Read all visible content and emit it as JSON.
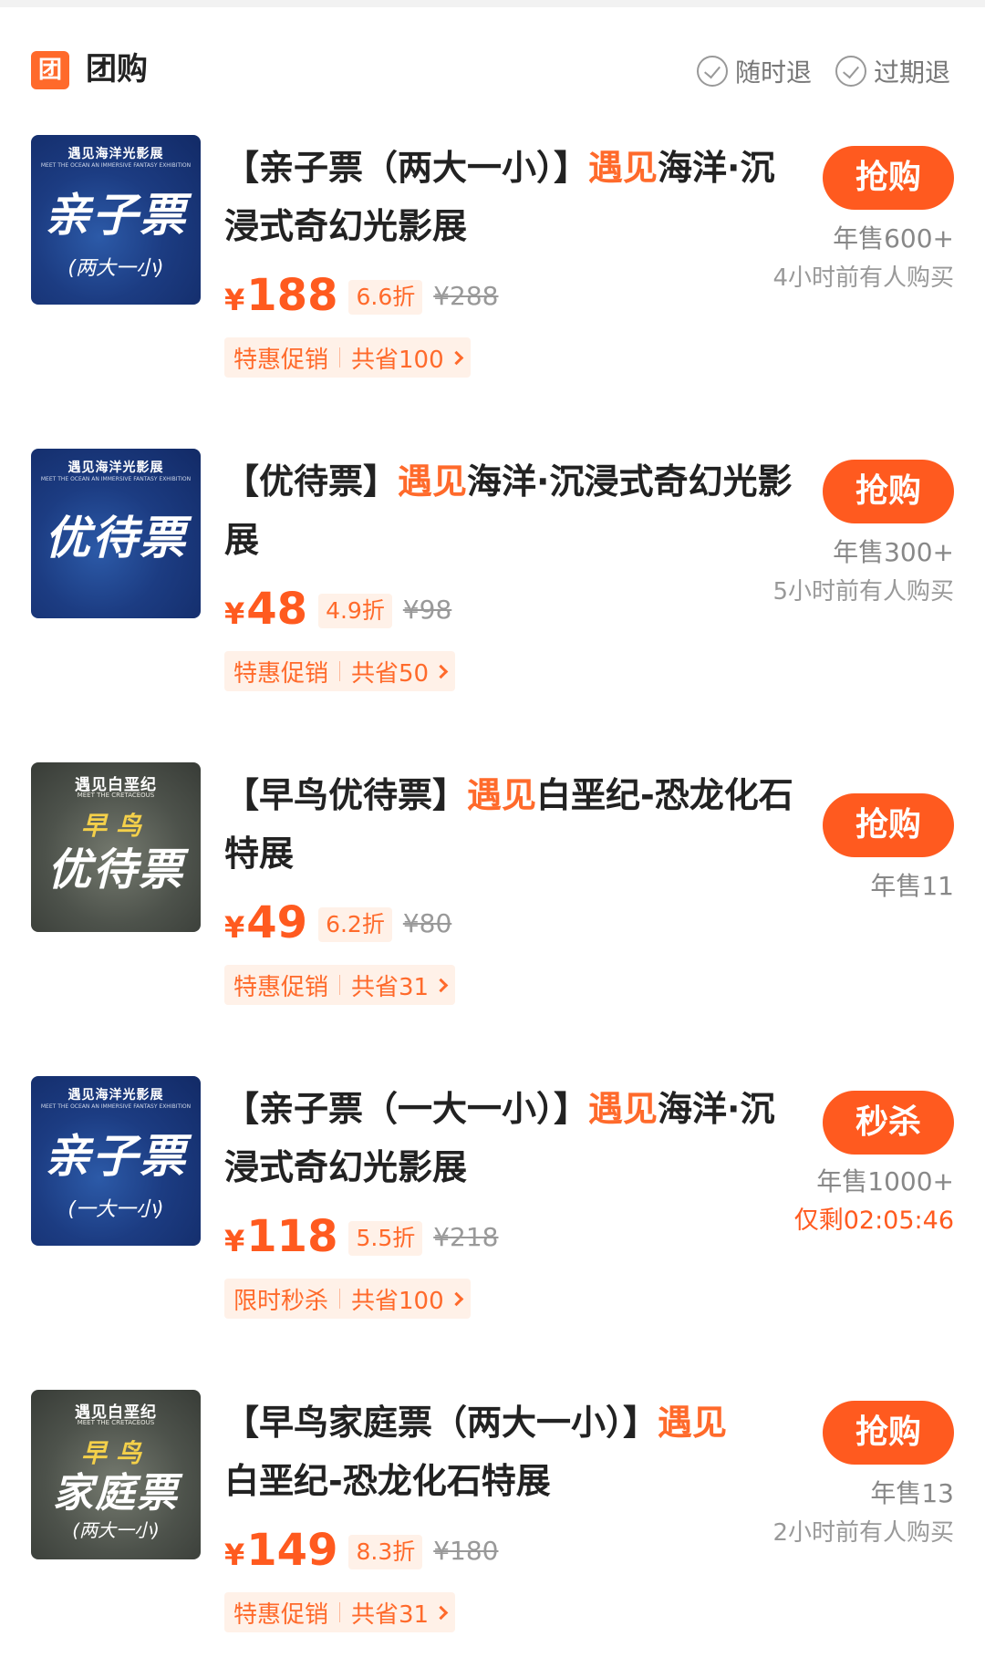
{
  "header": {
    "badge": "团",
    "title": "团购",
    "policies": [
      "随时退",
      "过期退"
    ]
  },
  "products": [
    {
      "thumb": {
        "top": "遇见海洋光影展",
        "sub": "MEET THE OCEAN AN IMMERSIVE FANTASY EXHIBITION",
        "early": "",
        "main": "亲子票",
        "note": "(两大一小)"
      },
      "title_pre": "【亲子票（两大一小）】",
      "title_hl": "遇见",
      "title_post": "海洋·沉浸式奇幻光影展",
      "price_symbol": "¥",
      "price": "188",
      "discount": "6.6折",
      "original": "¥288",
      "promo_label": "特惠促销",
      "promo_save": "共省100",
      "button": "抢购",
      "sales": "年售600+",
      "recent": "4小时前有人购买",
      "countdown": ""
    },
    {
      "thumb": {
        "top": "遇见海洋光影展",
        "sub": "MEET THE OCEAN AN IMMERSIVE FANTASY EXHIBITION",
        "early": "",
        "main": "优待票",
        "note": ""
      },
      "title_pre": "【优待票】",
      "title_hl": "遇见",
      "title_post": "海洋·沉浸式奇幻光影展",
      "price_symbol": "¥",
      "price": "48",
      "discount": "4.9折",
      "original": "¥98",
      "promo_label": "特惠促销",
      "promo_save": "共省50",
      "button": "抢购",
      "sales": "年售300+",
      "recent": "5小时前有人购买",
      "countdown": ""
    },
    {
      "thumb": {
        "top": "遇见白垩纪",
        "sub": "MEET THE CRETACEOUS",
        "early": "早鸟",
        "main": "优待票",
        "note": ""
      },
      "title_pre": "【早鸟优待票】",
      "title_hl": "遇见",
      "title_post": "白垩纪-恐龙化石特展",
      "price_symbol": "¥",
      "price": "49",
      "discount": "6.2折",
      "original": "¥80",
      "promo_label": "特惠促销",
      "promo_save": "共省31",
      "button": "抢购",
      "sales": "年售11",
      "recent": "",
      "countdown": ""
    },
    {
      "thumb": {
        "top": "遇见海洋光影展",
        "sub": "MEET THE OCEAN AN IMMERSIVE FANTASY EXHIBITION",
        "early": "",
        "main": "亲子票",
        "note": "(一大一小)"
      },
      "title_pre": "【亲子票（一大一小）】",
      "title_hl": "遇见",
      "title_post": "海洋·沉浸式奇幻光影展",
      "price_symbol": "¥",
      "price": "118",
      "discount": "5.5折",
      "original": "¥218",
      "promo_label": "限时秒杀",
      "promo_save": "共省100",
      "button": "秒杀",
      "sales": "年售1000+",
      "recent": "",
      "countdown": "仅剩02:05:46"
    },
    {
      "thumb": {
        "top": "遇见白垩纪",
        "sub": "MEET THE CRETACEOUS",
        "early": "早鸟",
        "main": "家庭票",
        "note": "(两大一小)"
      },
      "title_pre": "【早鸟家庭票（两大一小）】",
      "title_hl": "遇见",
      "title_post": "白垩纪-恐龙化石特展",
      "price_symbol": "¥",
      "price": "149",
      "discount": "8.3折",
      "original": "¥180",
      "promo_label": "特惠促销",
      "promo_save": "共省31",
      "button": "抢购",
      "sales": "年售13",
      "recent": "2小时前有人购买",
      "countdown": ""
    }
  ],
  "colors": {
    "accent": "#ff5a1f",
    "accent_light": "#fff1e8",
    "text": "#222222",
    "muted": "#999999"
  }
}
